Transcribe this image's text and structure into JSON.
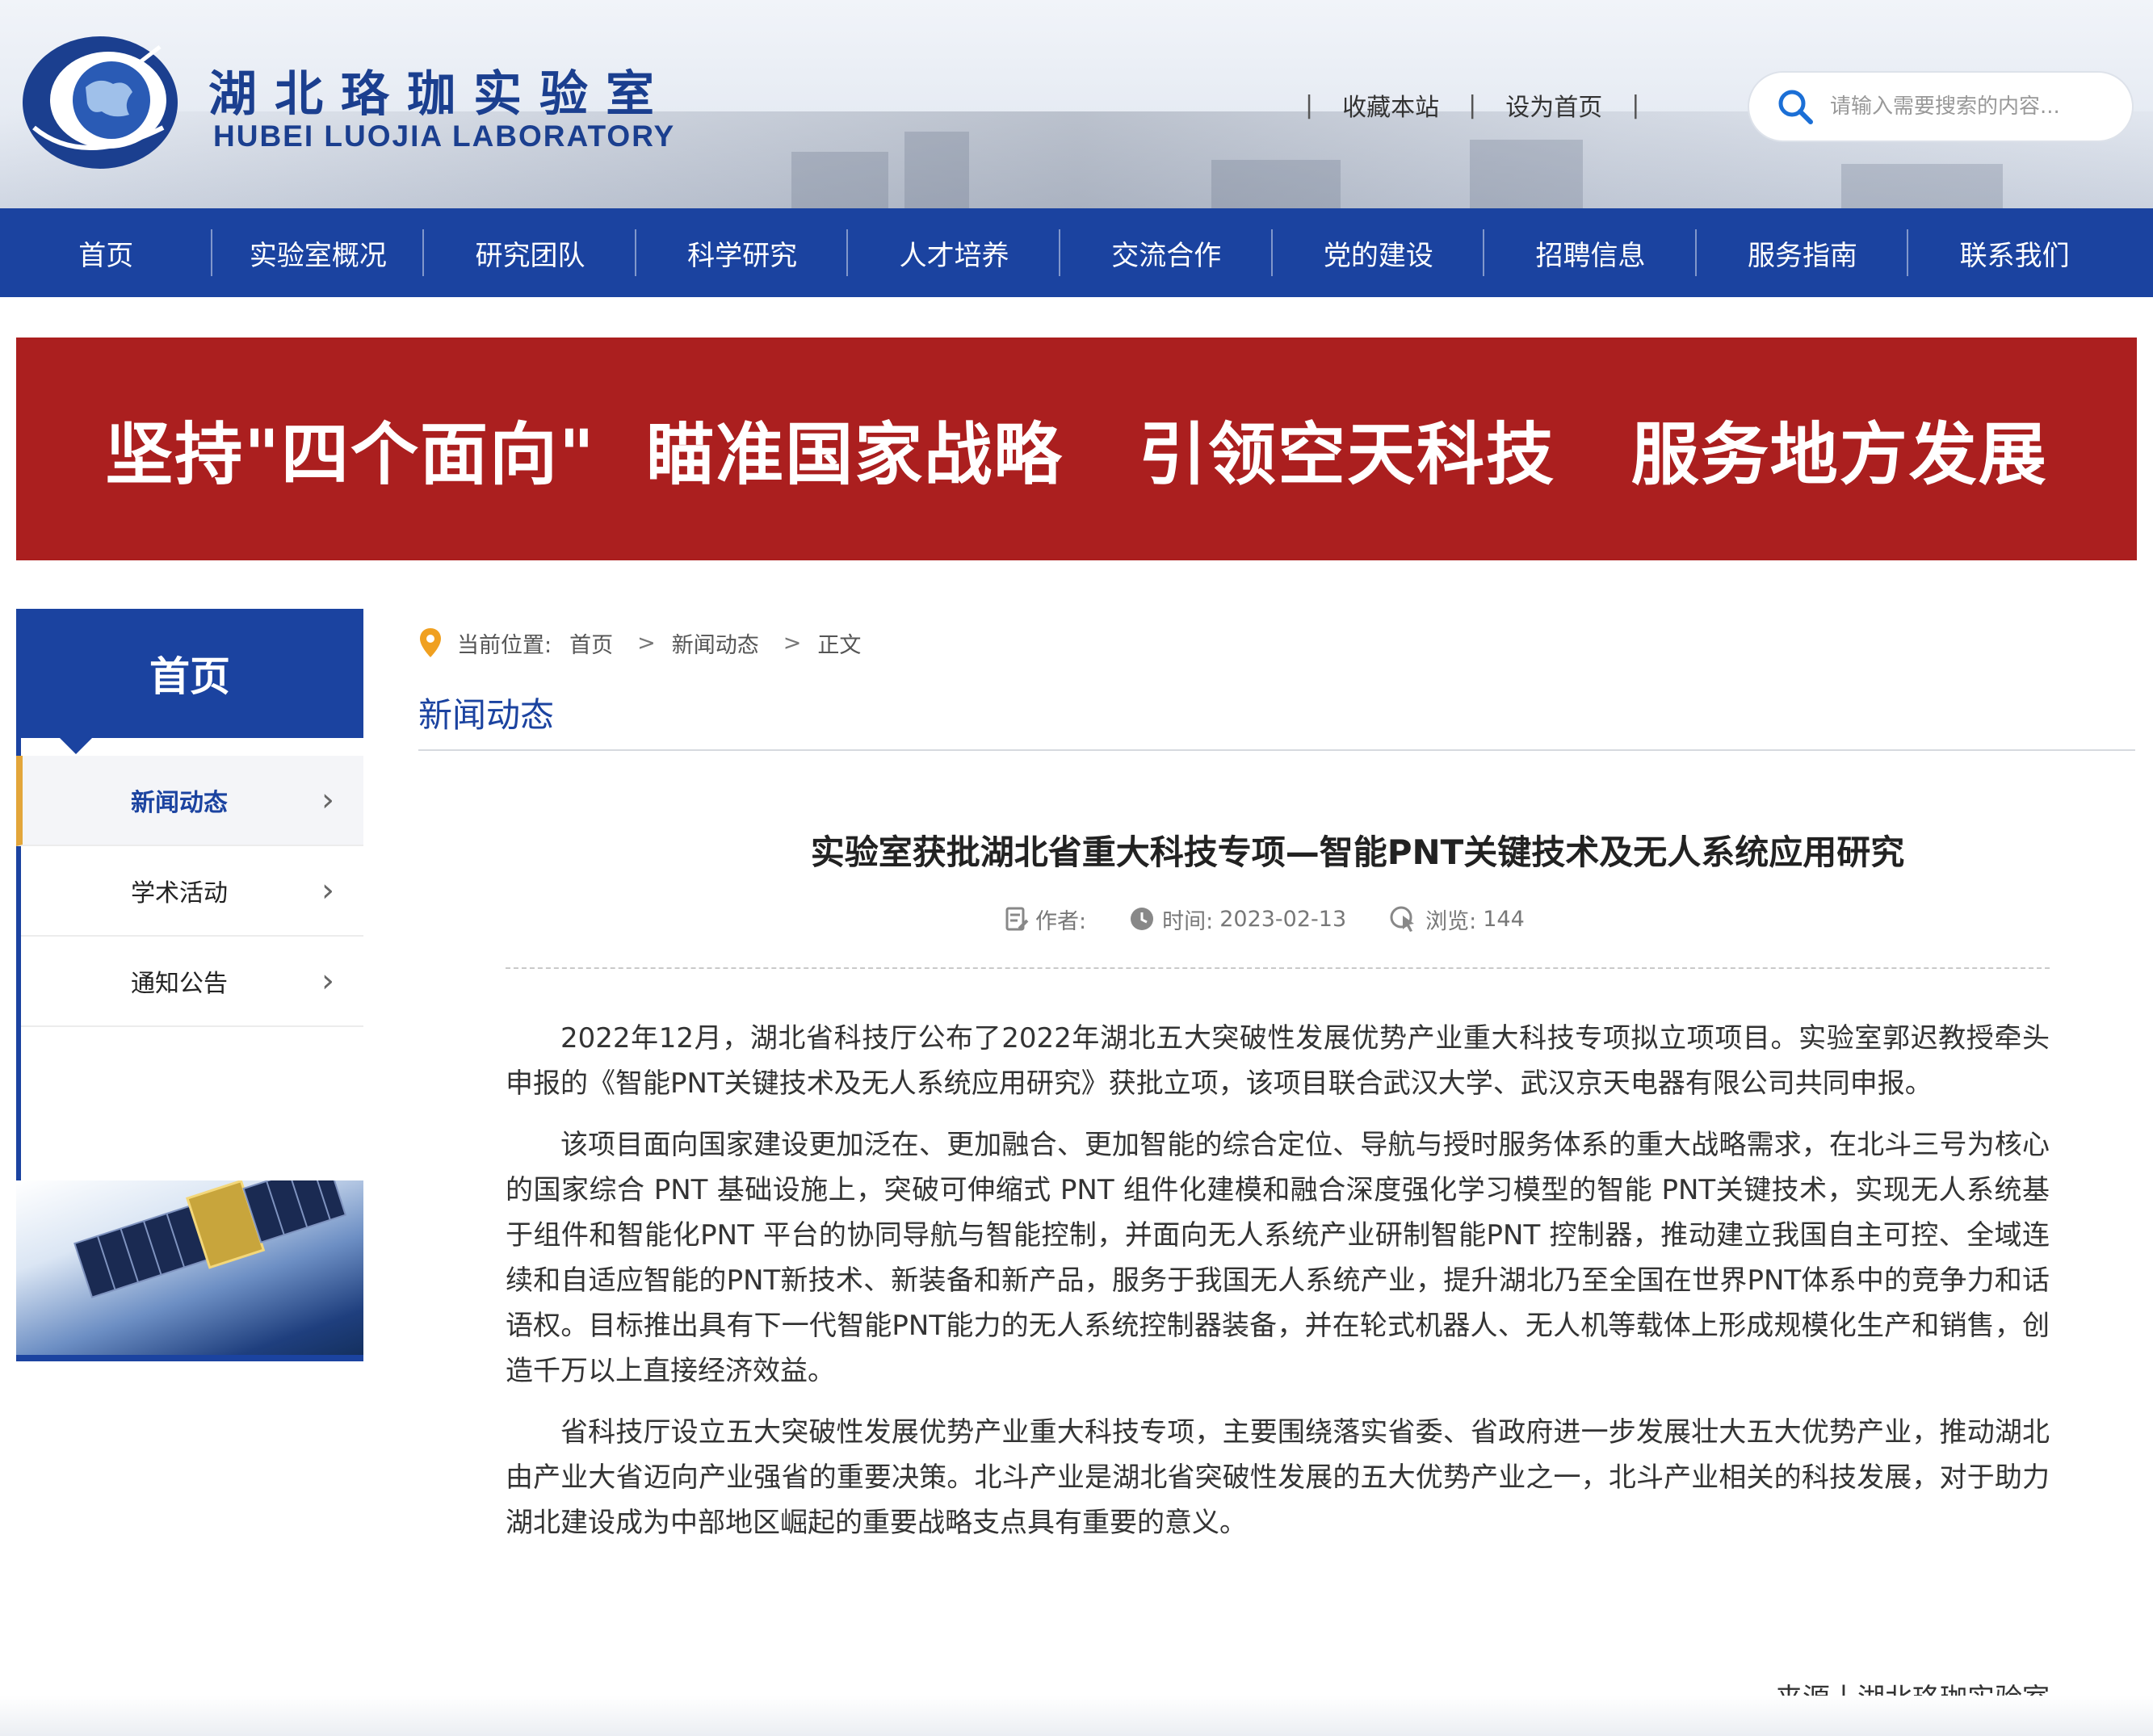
{
  "site": {
    "name_cn": "湖北珞珈实验室",
    "name_en": "HUBEI LUOJIA LABORATORY"
  },
  "top_links": {
    "sep": "|",
    "bookmark": "收藏本站",
    "homepage": "设为首页"
  },
  "search": {
    "placeholder": "请输入需要搜索的内容..."
  },
  "nav": {
    "items": [
      "首页",
      "实验室概况",
      "研究团队",
      "科学研究",
      "人才培养",
      "交流合作",
      "党的建设",
      "招聘信息",
      "服务指南",
      "联系我们"
    ]
  },
  "banner": {
    "text": "坚持\"四个面向\"  瞄准国家战略   引领空天科技   服务地方发展"
  },
  "sidebar": {
    "title": "首页",
    "items": [
      {
        "label": "新闻动态"
      },
      {
        "label": "学术活动"
      },
      {
        "label": "通知公告"
      }
    ]
  },
  "breadcrumb": {
    "prefix": "当前位置:",
    "items": [
      "首页",
      "新闻动态",
      "正文"
    ],
    "sep": ">"
  },
  "section": {
    "title": "新闻动态"
  },
  "article": {
    "title": "实验室获批湖北省重大科技专项—智能PNT关键技术及无人系统应用研究",
    "author_label": "作者:",
    "time_label": "时间:",
    "time_value": "2023-02-13",
    "views_label": "浏览:",
    "views_value": "144",
    "paragraphs": [
      "2022年12月，湖北省科技厅公布了2022年湖北五大突破性发展优势产业重大科技专项拟立项项目。实验室郭迟教授牵头申报的《智能PNT关键技术及无人系统应用研究》获批立项，该项目联合武汉大学、武汉京天电器有限公司共同申报。",
      "该项目面向国家建设更加泛在、更加融合、更加智能的综合定位、导航与授时服务体系的重大战略需求，在北斗三号为核心的国家综合 PNT 基础设施上，突破可伸缩式 PNT 组件化建模和融合深度强化学习模型的智能 PNT关键技术，实现无人系统基于组件和智能化PNT 平台的协同导航与智能控制，并面向无人系统产业研制智能PNT 控制器，推动建立我国自主可控、全域连续和自适应智能的PNT新技术、新装备和新产品，服务于我国无人系统产业，提升湖北乃至全国在世界PNT体系中的竞争力和话语权。目标推出具有下一代智能PNT能力的无人系统控制器装备，并在轮式机器人、无人机等载体上形成规模化生产和销售，创造千万以上直接经济效益。",
      "省科技厅设立五大突破性发展优势产业重大科技专项，主要围绕落实省委、省政府进一步发展壮大五大优势产业，推动湖北由产业大省迈向产业强省的重要决策。北斗产业是湖北省突破性发展的五大优势产业之一，北斗产业相关的科技发展，对于助力湖北建设成为中部地区崛起的重要战略支点具有重要的意义。"
    ],
    "source": "来源丨湖北珞珈实验室"
  },
  "colors": {
    "brand_blue": "#1b43a0",
    "banner_red": "#ab1f1f",
    "accent_gold": "#e3a63a"
  }
}
